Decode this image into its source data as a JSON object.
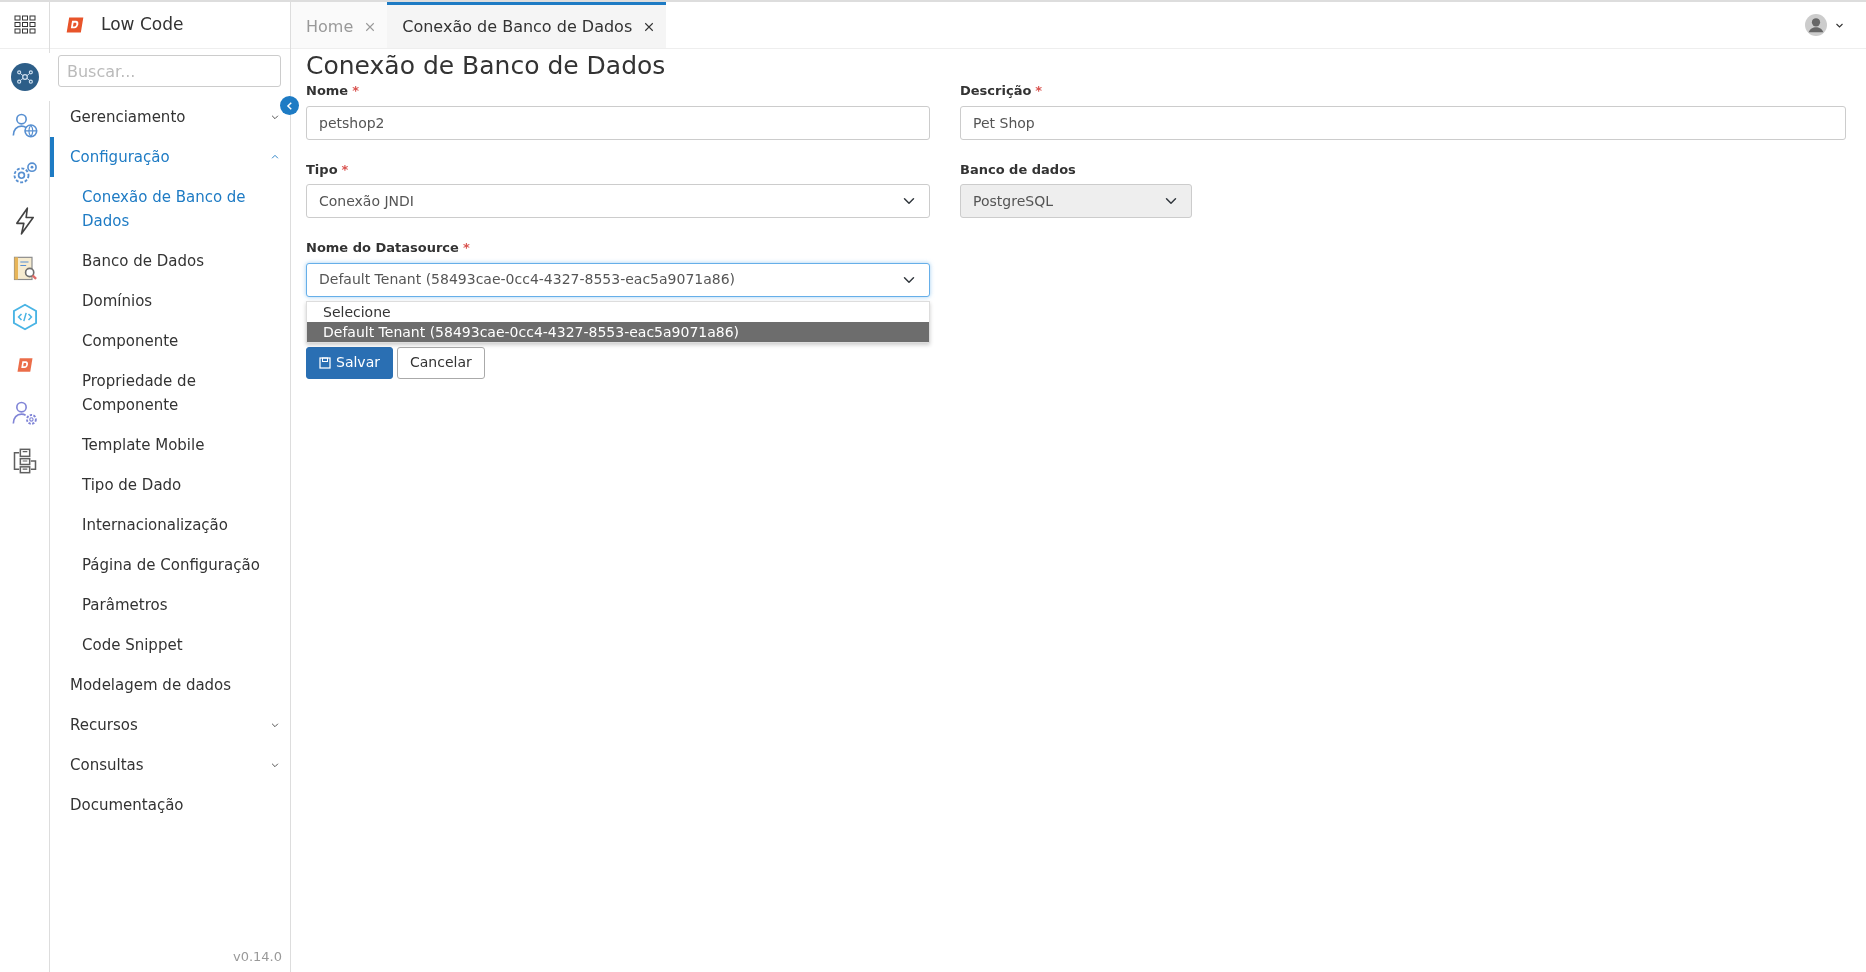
{
  "app": {
    "title": "Low Code"
  },
  "rail": [
    {
      "kind": "network",
      "selected": true
    },
    {
      "kind": "people-globe",
      "selected": false
    },
    {
      "kind": "gears",
      "selected": false
    },
    {
      "kind": "bolt",
      "selected": false
    },
    {
      "kind": "book-search",
      "selected": false
    },
    {
      "kind": "code",
      "selected": false
    },
    {
      "kind": "logo",
      "selected": false
    },
    {
      "kind": "person-gear",
      "selected": false
    },
    {
      "kind": "diagram",
      "selected": false
    }
  ],
  "search": {
    "placeholder": "Buscar..."
  },
  "sidebar": {
    "items": [
      {
        "label": "Gerenciamento",
        "kind": "group",
        "expanded": false,
        "selected": false
      },
      {
        "label": "Configuração",
        "kind": "group",
        "expanded": true,
        "selected": true,
        "children": [
          {
            "label": "Conexão de Banco de Dados",
            "selected": true
          },
          {
            "label": "Banco de Dados",
            "selected": false
          },
          {
            "label": "Domínios",
            "selected": false
          },
          {
            "label": "Componente",
            "selected": false
          },
          {
            "label": "Propriedade de Componente",
            "selected": false
          },
          {
            "label": "Template Mobile",
            "selected": false
          },
          {
            "label": "Tipo de Dado",
            "selected": false
          },
          {
            "label": "Internacionalização",
            "selected": false
          },
          {
            "label": "Página de Configuração",
            "selected": false
          },
          {
            "label": "Parâmetros",
            "selected": false
          },
          {
            "label": "Code Snippet",
            "selected": false
          }
        ]
      },
      {
        "label": "Modelagem de dados",
        "kind": "link",
        "selected": false
      },
      {
        "label": "Recursos",
        "kind": "group",
        "expanded": false,
        "selected": false
      },
      {
        "label": "Consultas",
        "kind": "group",
        "expanded": false,
        "selected": false
      },
      {
        "label": "Documentação",
        "kind": "link",
        "selected": false
      }
    ]
  },
  "version": "v0.14.0",
  "tabs": [
    {
      "label": "Home",
      "selected": false
    },
    {
      "label": "Conexão de Banco de Dados",
      "selected": true
    }
  ],
  "page": {
    "title": "Conexão de Banco de Dados"
  },
  "form": {
    "rows": [
      [
        {
          "label": "Nome",
          "required_mark": "*",
          "kind": "input",
          "value": "petshop2",
          "disabled": false,
          "focused": false
        },
        {
          "label": "Descrição",
          "required_mark": "*",
          "kind": "input",
          "value": "Pet Shop",
          "disabled": false,
          "focused": false
        }
      ],
      [
        {
          "label": "Tipo",
          "required_mark": "*",
          "kind": "select",
          "value": "Conexão JNDI",
          "disabled": false,
          "focused": false
        },
        {
          "label": "Banco de dados",
          "kind": "select",
          "value": "PostgreSQL",
          "disabled": true,
          "focused": false
        }
      ],
      [
        {
          "label": "Nome do Datasource",
          "required_mark": "*",
          "kind": "select",
          "value": "Default Tenant (58493cae-0cc4-4327-8553-eac5a9071a86)",
          "disabled": false,
          "focused": true,
          "open_options": [
            {
              "label": "Selecione",
              "selected": false
            },
            {
              "label": "Default Tenant (58493cae-0cc4-4327-8553-eac5a9071a86)",
              "selected": true
            }
          ]
        }
      ]
    ],
    "buttons": [
      {
        "label": "Salvar",
        "kind": "primary"
      },
      {
        "label": "Cancelar",
        "kind": "secondary"
      }
    ]
  }
}
